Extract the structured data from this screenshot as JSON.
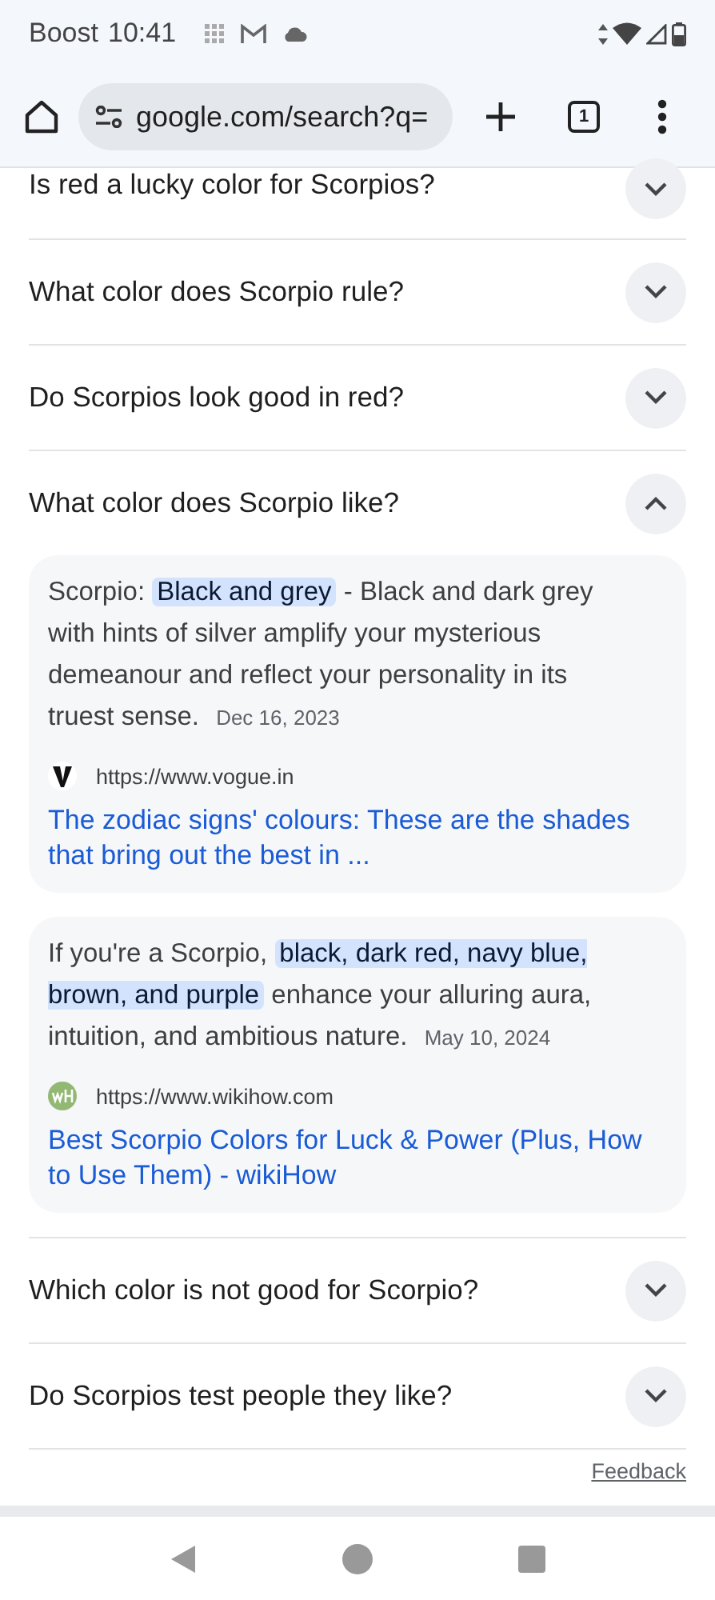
{
  "status_bar": {
    "carrier": "Boost",
    "time": "10:41"
  },
  "toolbar": {
    "url": "google.com/search?q=",
    "tab_count": "1"
  },
  "questions": [
    {
      "text": "Is red a lucky color for Scorpios?",
      "expanded": false
    },
    {
      "text": "What color does Scorpio rule?",
      "expanded": false
    },
    {
      "text": "Do Scorpios look good in red?",
      "expanded": false
    },
    {
      "text": "What color does Scorpio like?",
      "expanded": true,
      "answers": [
        {
          "text": "Scorpio: **Black and grey** - Black and dark grey with hints of silver amplify your mysterious demeanour and reflect your personality in its truest sense.",
          "date": "Dec 16, 2023",
          "kind": "vogue",
          "source": "https://www.vogue.in",
          "link": "The zodiac signs' colours: These are the shades that bring out the best in ..."
        },
        {
          "text": "If you're a Scorpio, **black, dark red, navy blue, brown, and purple** enhance your alluring aura, intuition, and ambitious nature.",
          "date": "May 10, 2024",
          "kind": "wikihow",
          "source": "https://www.wikihow.com",
          "link": "Best Scorpio Colors for Luck & Power (Plus, How to Use Them) - wikiHow"
        }
      ]
    },
    {
      "text": "Which color is not good for Scorpio?",
      "expanded": false
    },
    {
      "text": "Do Scorpios test people they like?",
      "expanded": false
    }
  ],
  "footer": {
    "feedback": "Feedback"
  }
}
